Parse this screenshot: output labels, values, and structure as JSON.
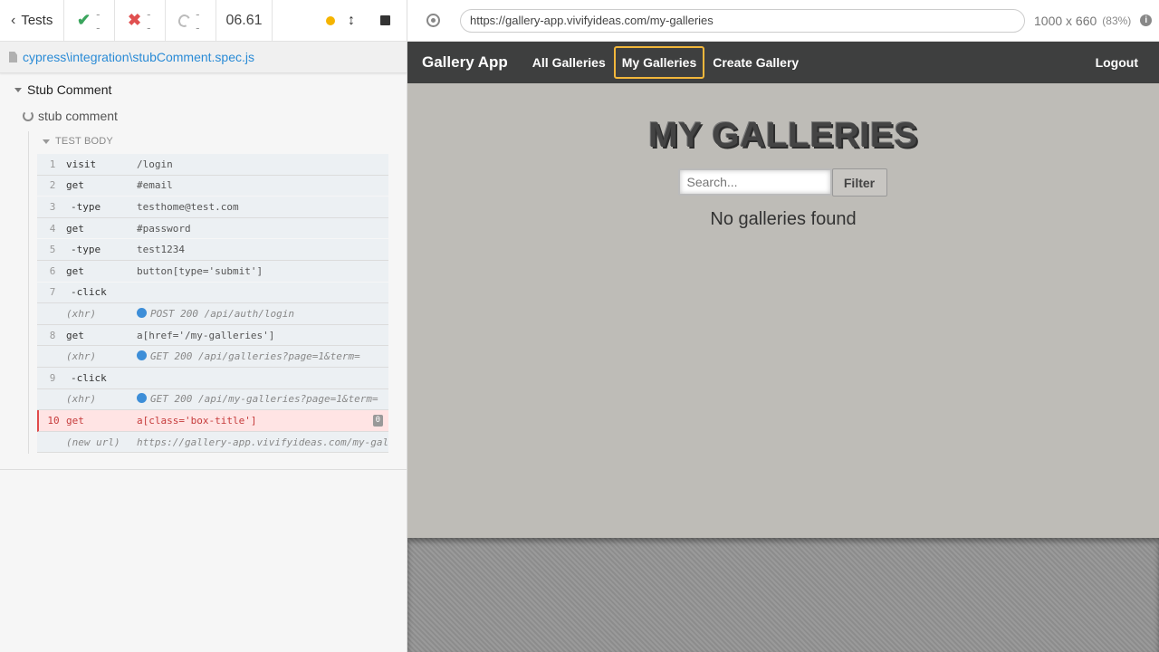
{
  "reporter": {
    "header": {
      "tests_label": "Tests",
      "passed": "--",
      "failed": "--",
      "pending": "--",
      "duration": "06.61"
    },
    "spec_path": "cypress\\integration\\stubComment.spec.js",
    "suite_title": "Stub Comment",
    "test_title": "stub comment",
    "test_body_label": "TEST BODY",
    "commands": [
      {
        "num": "1",
        "name": "visit",
        "msg": "/login",
        "kind": "parent",
        "end": true
      },
      {
        "num": "2",
        "name": "get",
        "msg": "#email",
        "kind": "parent"
      },
      {
        "num": "3",
        "name": "-type",
        "msg": "testhome@test.com",
        "kind": "child",
        "end": true
      },
      {
        "num": "4",
        "name": "get",
        "msg": "#password",
        "kind": "parent"
      },
      {
        "num": "5",
        "name": "-type",
        "msg": "test1234",
        "kind": "child",
        "end": true
      },
      {
        "num": "6",
        "name": "get",
        "msg": "button[type='submit']",
        "kind": "parent"
      },
      {
        "num": "7",
        "name": "-click",
        "msg": "",
        "kind": "child",
        "end": true
      },
      {
        "num": "",
        "name": "(xhr)",
        "msg": "POST 200 /api/auth/login",
        "kind": "xhr",
        "end": true
      },
      {
        "num": "8",
        "name": "get",
        "msg": "a[href='/my-galleries']",
        "kind": "parent",
        "end": true
      },
      {
        "num": "",
        "name": "(xhr)",
        "msg": "GET 200 /api/galleries?page=1&term=",
        "kind": "xhr",
        "end": true
      },
      {
        "num": "9",
        "name": "-click",
        "msg": "",
        "kind": "child",
        "end": true
      },
      {
        "num": "",
        "name": "(xhr)",
        "msg": "GET 200 /api/my-galleries?page=1&term=",
        "kind": "xhr",
        "end": true
      },
      {
        "num": "10",
        "name": "get",
        "msg": "a[class='box-title']",
        "kind": "failed",
        "badge": "0",
        "end": true
      },
      {
        "num": "",
        "name": "(new url)",
        "msg": "https://gallery-app.vivifyideas.com/my-galleries",
        "kind": "event",
        "end": true
      }
    ]
  },
  "aut": {
    "url": "https://gallery-app.vivifyideas.com/my-galleries",
    "viewport_size": "1000 x 660",
    "viewport_scale": "(83%)",
    "app": {
      "brand": "Gallery App",
      "nav": [
        "All Galleries",
        "My Galleries",
        "Create Gallery"
      ],
      "active_nav": "My Galleries",
      "logout": "Logout",
      "page_title": "MY GALLERIES",
      "search_placeholder": "Search...",
      "filter_label": "Filter",
      "empty_message": "No galleries found"
    }
  },
  "colors": {
    "accent_link": "#2a8bd6",
    "pass": "#3ba55d",
    "fail": "#e05050",
    "xhr": "#3d8ed8",
    "active_nav_border": "#f2b73b",
    "app_nav_bg": "#3e3f3f",
    "app_bg": "#bebcb7"
  },
  "icons": {
    "back": "chevron-left-icon",
    "pass": "check-icon",
    "fail": "x-icon",
    "pending": "circle-spinner-icon",
    "selector": "crosshair-icon",
    "info": "info-icon"
  }
}
